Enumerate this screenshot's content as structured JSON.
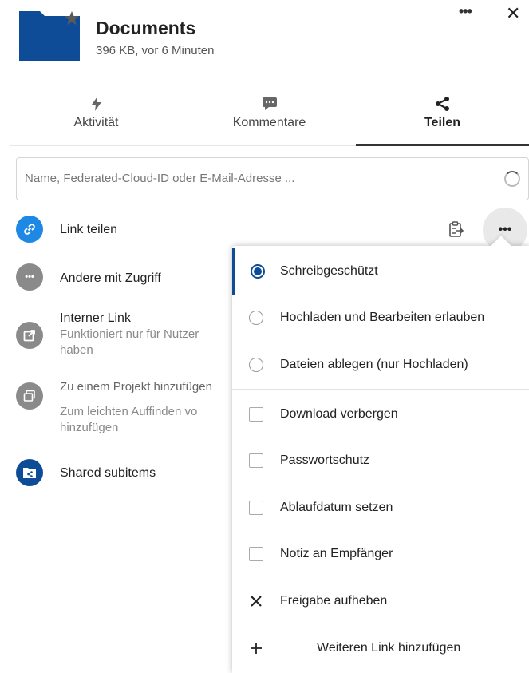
{
  "header": {
    "title": "Documents",
    "subtitle": "396 KB, vor 6 Minuten",
    "more_icon": "more-horizontal-icon",
    "close_icon": "close-icon",
    "folder_icon": "folder-icon",
    "favorite_icon": "star-icon"
  },
  "tabs": [
    {
      "label": "Aktivität",
      "icon": "activity-icon",
      "active": false
    },
    {
      "label": "Kommentare",
      "icon": "comment-icon",
      "active": false
    },
    {
      "label": "Teilen",
      "icon": "share-icon",
      "active": true
    }
  ],
  "search": {
    "placeholder": "Name, Federated-Cloud-ID oder E-Mail-Adresse ..."
  },
  "shares": {
    "link_label": "Link teilen",
    "others_label": "Andere mit Zugriff",
    "internal_title": "Interner Link",
    "internal_desc_line1": "Funktioniert nur für Nutzer",
    "internal_desc_line2": "haben",
    "project_title": "Zu einem Projekt hinzufügen",
    "project_desc_line1": "Zum leichten Auffinden vo",
    "project_desc_line2": "hinzufügen",
    "subitems_label": "Shared subitems"
  },
  "menu": {
    "radio_options": [
      {
        "label": "Schreibgeschützt",
        "checked": true
      },
      {
        "label": "Hochladen und Bearbeiten erlauben",
        "checked": false
      },
      {
        "label": "Dateien ablegen (nur Hochladen)",
        "checked": false
      }
    ],
    "checkbox_options": [
      {
        "label": "Download verbergen",
        "checked": false
      },
      {
        "label": "Passwortschutz",
        "checked": false
      },
      {
        "label": "Ablaufdatum setzen",
        "checked": false
      },
      {
        "label": "Notiz an Empfänger",
        "checked": false
      }
    ],
    "unshare_label": "Freigabe aufheben",
    "add_link_label": "Weiteren Link hinzufügen"
  },
  "colors": {
    "brand": "#0f4c97",
    "link_avatar": "#1e88e5",
    "grey_avatar": "#8a8a8a"
  }
}
